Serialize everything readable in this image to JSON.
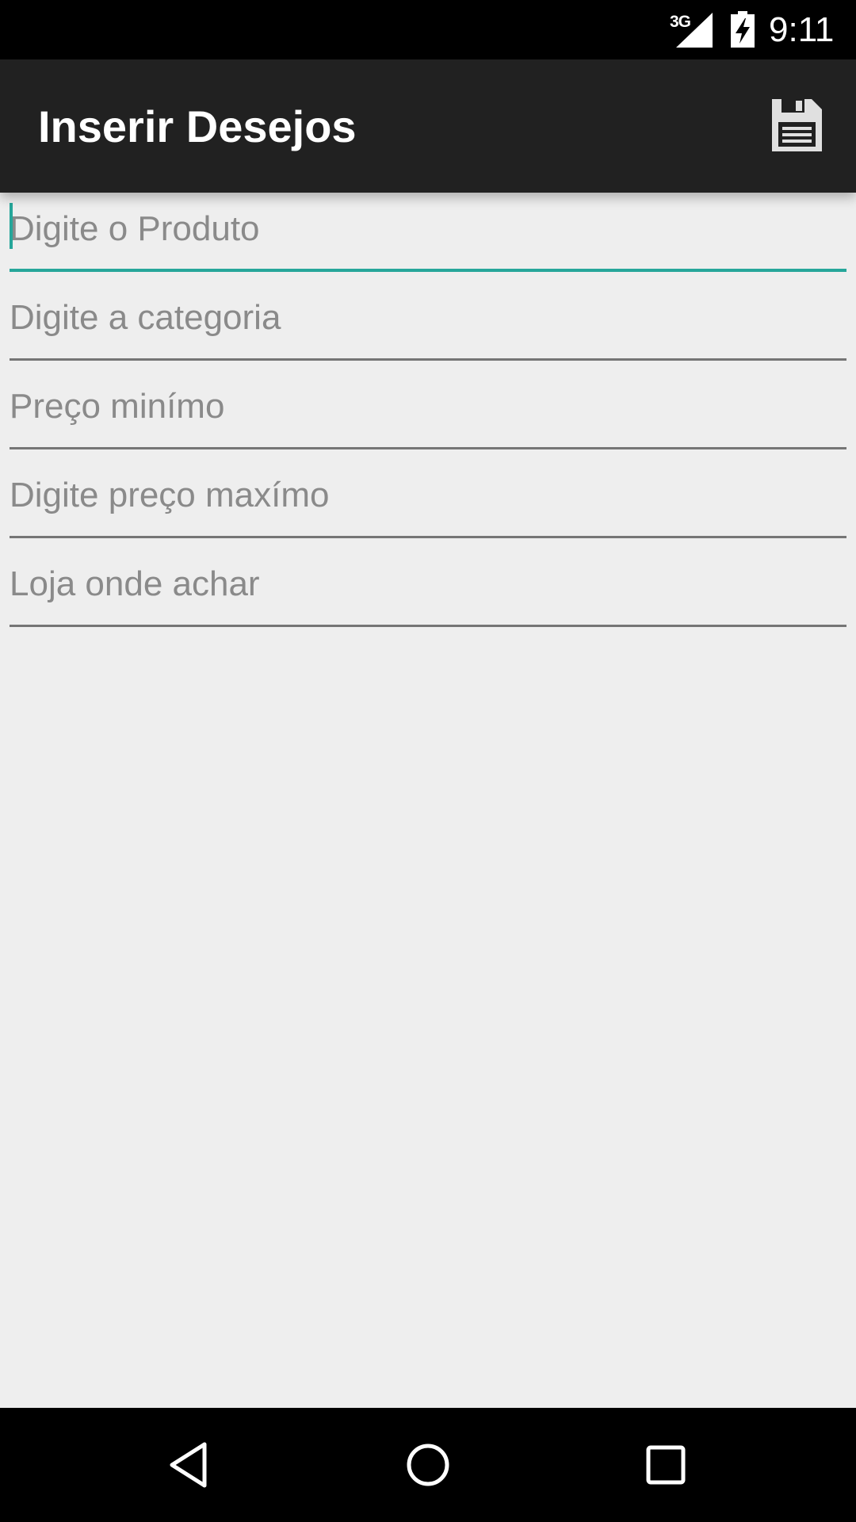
{
  "status_bar": {
    "network": "3G",
    "time": "9:11",
    "icons": [
      "signal-icon",
      "battery-charging-icon"
    ]
  },
  "app_bar": {
    "title": "Inserir Desejos",
    "action_icon": "save-icon"
  },
  "form": {
    "fields": [
      {
        "placeholder": "Digite o Produto",
        "value": "",
        "focused": true
      },
      {
        "placeholder": "Digite a categoria",
        "value": "",
        "focused": false
      },
      {
        "placeholder": "Preço minímo",
        "value": "",
        "focused": false
      },
      {
        "placeholder": "Digite preço maxímo",
        "value": "",
        "focused": false
      },
      {
        "placeholder": "Loja onde achar",
        "value": "",
        "focused": false
      }
    ]
  },
  "nav_bar": {
    "icons": [
      "back-icon",
      "home-icon",
      "recent-apps-icon"
    ]
  },
  "colors": {
    "status_bar": "#000000",
    "app_bar": "#212121",
    "background": "#eeeeee",
    "accent": "#26a69a",
    "underline": "#757575",
    "placeholder": "#8a8a8a"
  }
}
